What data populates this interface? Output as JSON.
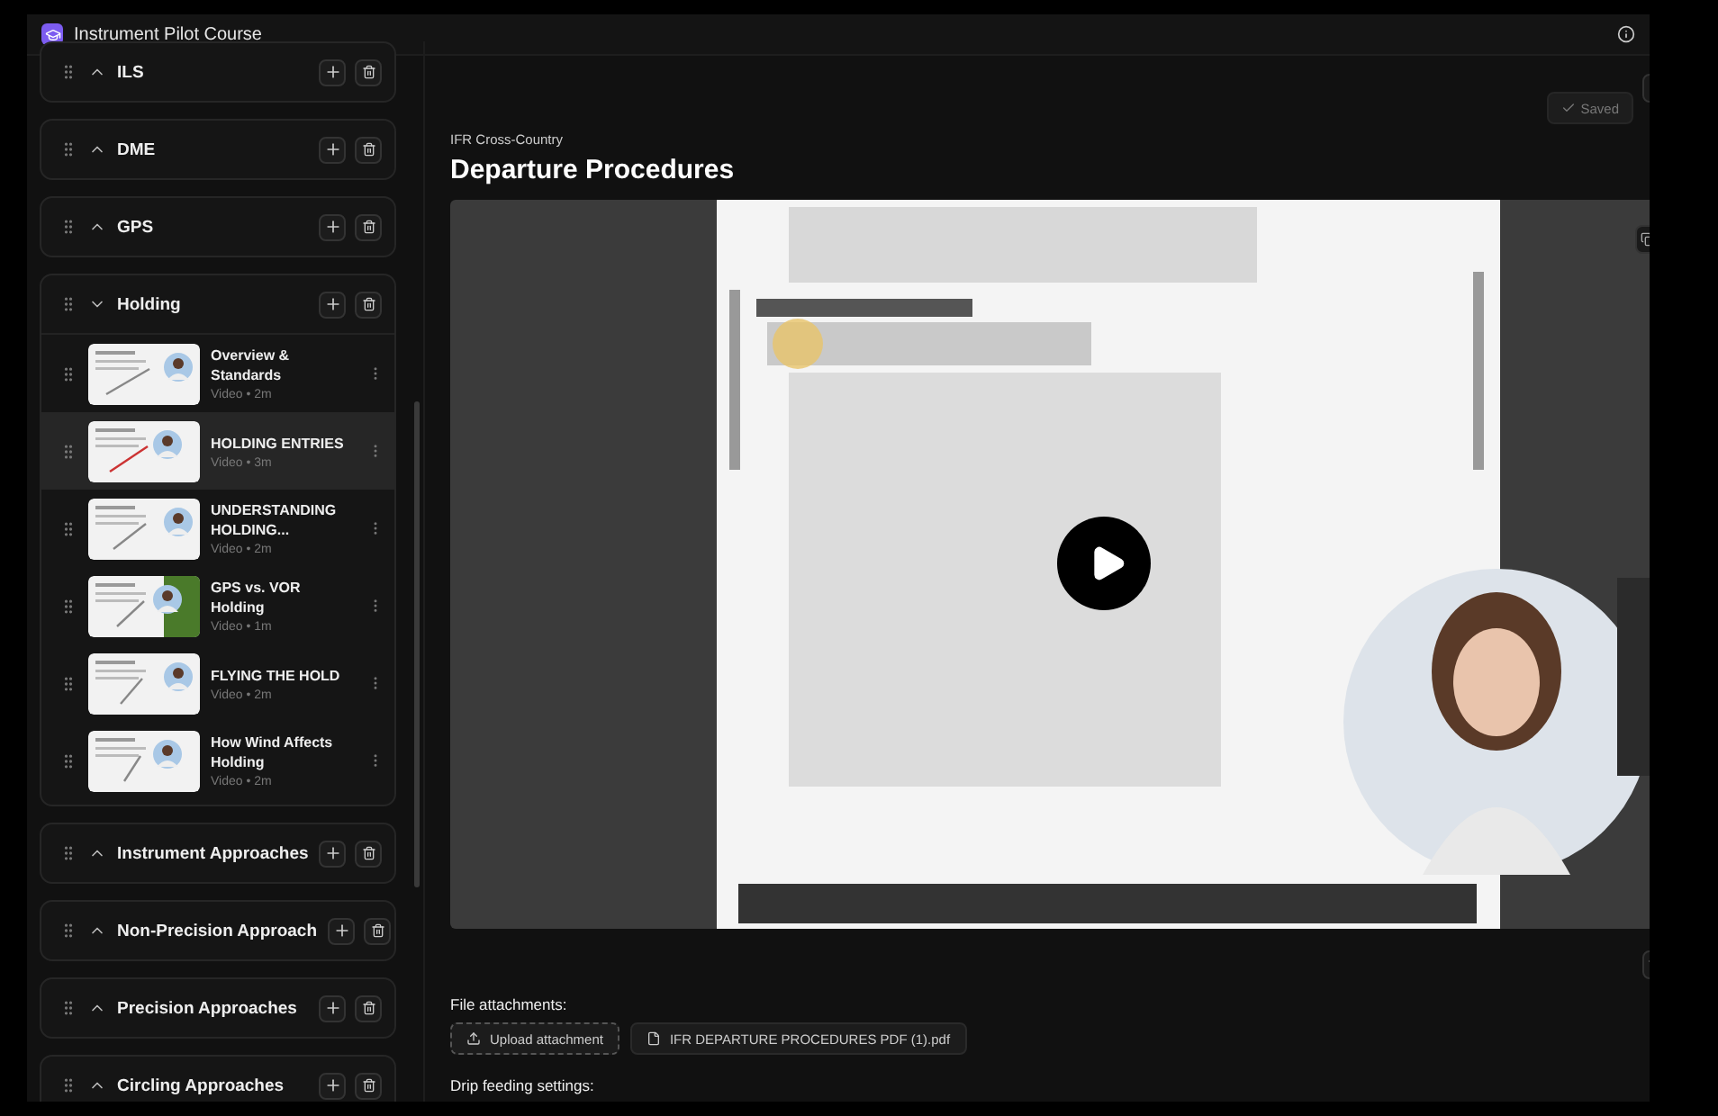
{
  "app": {
    "title": "Instrument Pilot Course"
  },
  "sections": [
    {
      "title": "ILS",
      "expanded": false
    },
    {
      "title": "DME",
      "expanded": false
    },
    {
      "title": "GPS",
      "expanded": false
    },
    {
      "title": "Holding",
      "expanded": true,
      "lessons": [
        {
          "title": "Overview & Standards",
          "meta": "Video • 2m",
          "selected": false
        },
        {
          "title": "HOLDING ENTRIES",
          "meta": "Video • 3m",
          "selected": true
        },
        {
          "title": "UNDERSTANDING HOLDING...",
          "meta": "Video • 2m",
          "selected": false
        },
        {
          "title": "GPS vs. VOR Holding",
          "meta": "Video • 1m",
          "selected": false
        },
        {
          "title": "FLYING THE HOLD",
          "meta": "Video • 2m",
          "selected": false
        },
        {
          "title": "How Wind Affects Holding",
          "meta": "Video • 2m",
          "selected": false
        }
      ]
    },
    {
      "title": "Instrument Approaches",
      "expanded": false
    },
    {
      "title": "Non-Precision Approach",
      "expanded": false
    },
    {
      "title": "Precision Approaches",
      "expanded": false
    },
    {
      "title": "Circling Approaches",
      "expanded": false
    }
  ],
  "lesson": {
    "breadcrumb": "IFR Cross-Country",
    "title": "Departure Procedures",
    "save_status": "Saved"
  },
  "attachments": {
    "label": "File attachments:",
    "upload": "Upload attachment",
    "files": [
      "IFR DEPARTURE PROCEDURES PDF (1).pdf"
    ]
  },
  "drip": {
    "label": "Drip feeding settings:"
  }
}
